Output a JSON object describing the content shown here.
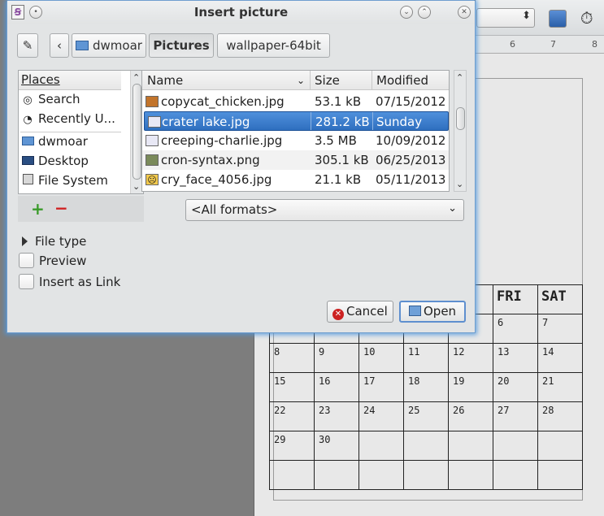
{
  "dialog": {
    "title": "Insert picture",
    "path": [
      "dwmoar",
      "Pictures",
      "wallpaper-64bit"
    ],
    "places": {
      "header": "Places",
      "items": [
        {
          "label": "Search",
          "icon": "binoculars-icon"
        },
        {
          "label": "Recently U...",
          "icon": "recent-clock-icon"
        },
        {
          "label": "dwmoar",
          "icon": "home-folder-icon"
        },
        {
          "label": "Desktop",
          "icon": "desktop-icon"
        },
        {
          "label": "File System",
          "icon": "drive-icon"
        }
      ]
    },
    "files": {
      "columns": {
        "name": "Name",
        "size": "Size",
        "modified": "Modified"
      },
      "rows": [
        {
          "name": "copycat_chicken.jpg",
          "size": "53.1 kB",
          "modified": "07/15/2012",
          "selected": false
        },
        {
          "name": "crater lake.jpg",
          "size": "281.2 kB",
          "modified": "Sunday",
          "selected": true
        },
        {
          "name": "creeping-charlie.jpg",
          "size": "3.5 MB",
          "modified": "10/09/2012",
          "selected": false
        },
        {
          "name": "cron-syntax.png",
          "size": "305.1 kB",
          "modified": "06/25/2013",
          "selected": false
        },
        {
          "name": "cry_face_4056.jpg",
          "size": "21.1 kB",
          "modified": "05/11/2013",
          "selected": false
        }
      ]
    },
    "format_filter": "<All formats>",
    "file_type_label": "File type",
    "preview_label": "Preview",
    "insert_as_link_label": "Insert as Link",
    "cancel_label": "Cancel",
    "open_label": "Open",
    "selection_color": "#3a7ccc"
  },
  "background": {
    "ruler_numbers": [
      "6",
      "7",
      "8"
    ],
    "calendar": {
      "headers": [
        "",
        "",
        "",
        "",
        "",
        "FRI",
        "SAT"
      ],
      "rows": [
        [
          "",
          "",
          "",
          "",
          "",
          "6",
          "7"
        ],
        [
          "8",
          "9",
          "10",
          "11",
          "12",
          "13",
          "14"
        ],
        [
          "15",
          "16",
          "17",
          "18",
          "19",
          "20",
          "21"
        ],
        [
          "22",
          "23",
          "24",
          "25",
          "26",
          "27",
          "28"
        ],
        [
          "29",
          "30",
          "",
          "",
          "",
          "",
          ""
        ],
        [
          "",
          "",
          "",
          "",
          "",
          "",
          ""
        ]
      ]
    }
  }
}
